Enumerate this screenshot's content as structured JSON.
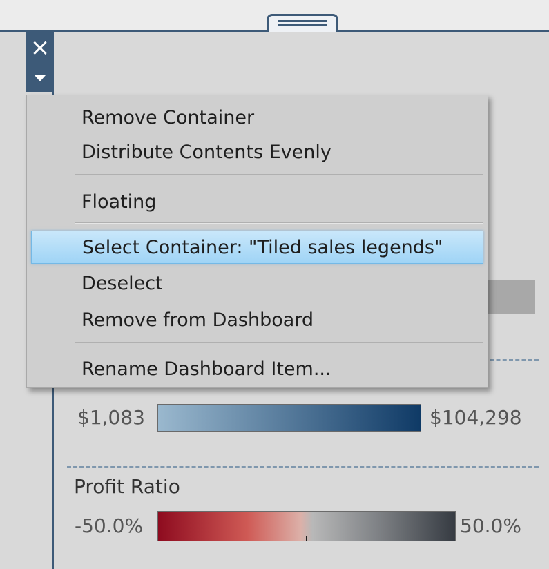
{
  "context_menu": {
    "items": [
      {
        "label": "Remove Container",
        "selected": false
      },
      {
        "label": "Distribute Contents Evenly",
        "selected": false
      },
      {
        "label": "Floating",
        "selected": false
      },
      {
        "label": "Select Container: \"Tiled sales legends\"",
        "selected": true
      },
      {
        "label": "Deselect",
        "selected": false
      },
      {
        "label": "Remove from Dashboard",
        "selected": false
      },
      {
        "label": "Rename Dashboard Item...",
        "selected": false
      }
    ]
  },
  "controls": {
    "close_glyph": "×",
    "close_icon": "close-icon",
    "menu_icon": "dropdown-triangle-icon"
  },
  "legends": {
    "sales": {
      "min_label": "$1,083",
      "max_label": "$104,298",
      "color_start": "#9ab8ce",
      "color_end": "#0f3a66"
    },
    "profit_ratio": {
      "title": "Profit Ratio",
      "min_label": "-50.0%",
      "max_label": "50.0%",
      "color_start": "#8e0b1f",
      "color_end": "#363b42"
    }
  },
  "colors": {
    "container_border": "#3d5a78",
    "selection_highlight": "#9fd4f6",
    "menu_background": "#cfcfcf"
  }
}
